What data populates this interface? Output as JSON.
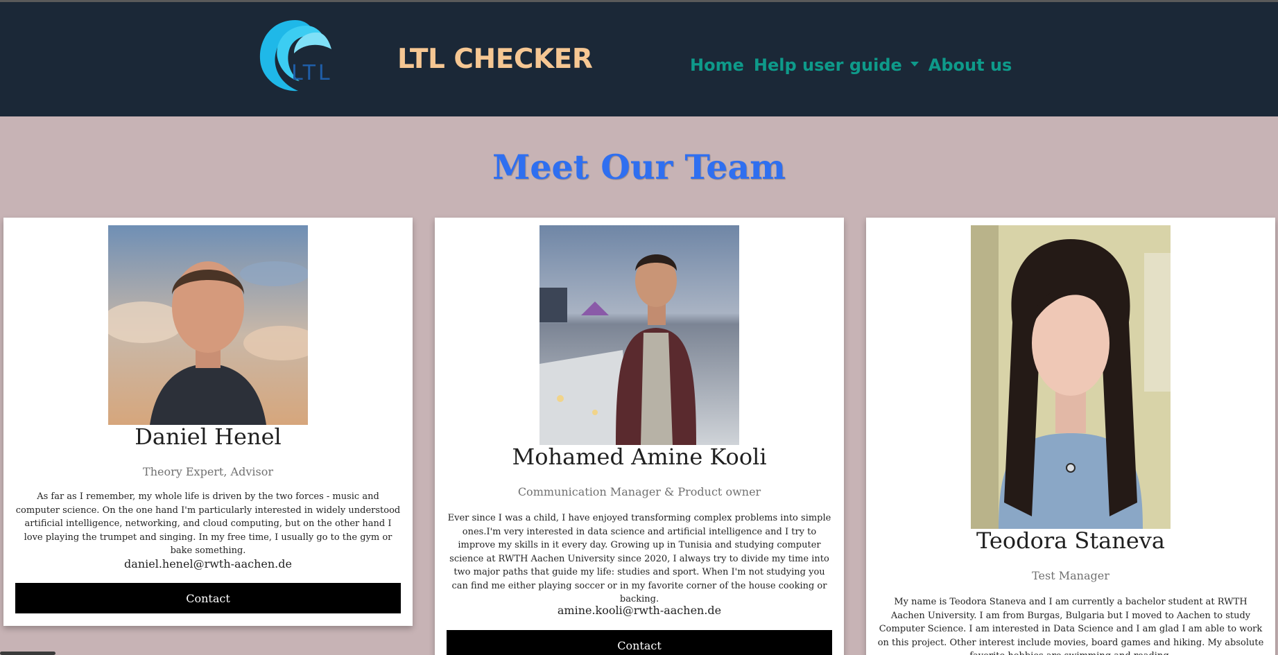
{
  "header": {
    "logo_text": "LTL",
    "brand": "LTL CHECKER",
    "nav": [
      {
        "label": "Home"
      },
      {
        "label": "Help user guide"
      },
      {
        "label": "About us"
      }
    ]
  },
  "page": {
    "title": "Meet Our Team"
  },
  "team": [
    {
      "name": "Daniel Henel",
      "role": "Theory Expert, Advisor",
      "bio": "As far as I remember, my whole life is driven by the two forces - music and computer science. On the one hand I'm particularly interested in widely understood artificial intelligence, networking, and cloud computing, but on the other hand I love playing the trumpet and singing. In my free time, I usually go to the gym or bake something.",
      "email": "daniel.henel@rwth-aachen.de",
      "contact_label": "Contact"
    },
    {
      "name": "Mohamed Amine Kooli",
      "role": "Communication Manager & Product owner",
      "bio": "Ever since I was a child, I have enjoyed transforming complex problems into simple ones.I'm very interested in data science and artificial intelligence and I try to improve my skills in it every day. Growing up in Tunisia and studying computer science at RWTH Aachen University since 2020, I always try to divide my time into two major paths that guide my life: studies and sport. When I'm not studying you can find me either playing soccer or in my favorite corner of the house cooking or backing.",
      "email": "amine.kooli@rwth-aachen.de",
      "contact_label": "Contact"
    },
    {
      "name": "Teodora Staneva",
      "role": "Test Manager",
      "bio": "My name is Teodora Staneva and I am currently a bachelor student at RWTH Aachen University. I am from Burgas, Bulgaria but I moved to Aachen to study Computer Science. I am interested in Data Science and I am glad I am able to work on this project. Other interest include movies, board games and hiking. My absolute favorite hobbies are swimming and reading.",
      "email": "",
      "contact_label": ""
    }
  ],
  "colors": {
    "navbar_bg": "#1b2837",
    "brand": "#f6c793",
    "nav_link": "#0e9a8a",
    "title": "#2f6ff0",
    "page_bg": "#c7b3b5"
  }
}
